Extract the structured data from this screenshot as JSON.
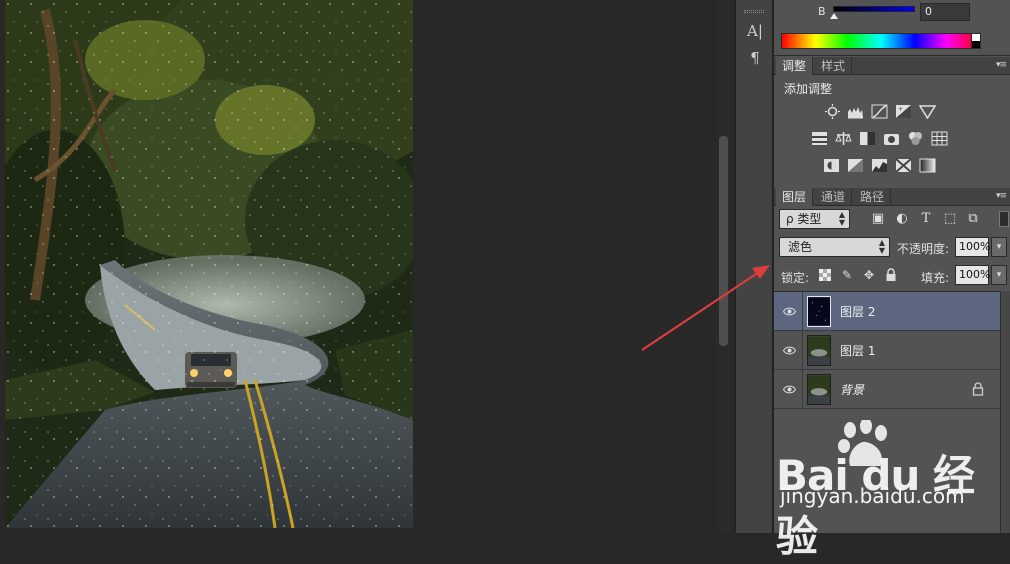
{
  "color_panel": {
    "slider_b_label": "B",
    "slider_b_value": "0"
  },
  "adjust_panel": {
    "tabs": [
      "调整",
      "样式"
    ],
    "title": "添加调整"
  },
  "layers_panel": {
    "tabs": [
      "图层",
      "通道",
      "路径"
    ],
    "filter_label": "ρ 类型",
    "blend_mode": "滤色",
    "opacity_label": "不透明度:",
    "opacity_value": "100%",
    "lock_label": "锁定:",
    "fill_label": "填充:",
    "fill_value": "100%",
    "layers": [
      {
        "name": "图层 2",
        "selected": true
      },
      {
        "name": "图层 1",
        "selected": false
      },
      {
        "name": "背景",
        "selected": false,
        "locked": true
      }
    ]
  },
  "watermark": {
    "logo": "Bai du 经验",
    "url": "jingyan.baidu.com"
  },
  "colors": {
    "annotation_arrow": "#e03c3c",
    "selected_layer": "#5c677f",
    "panel_bg": "#535353"
  }
}
